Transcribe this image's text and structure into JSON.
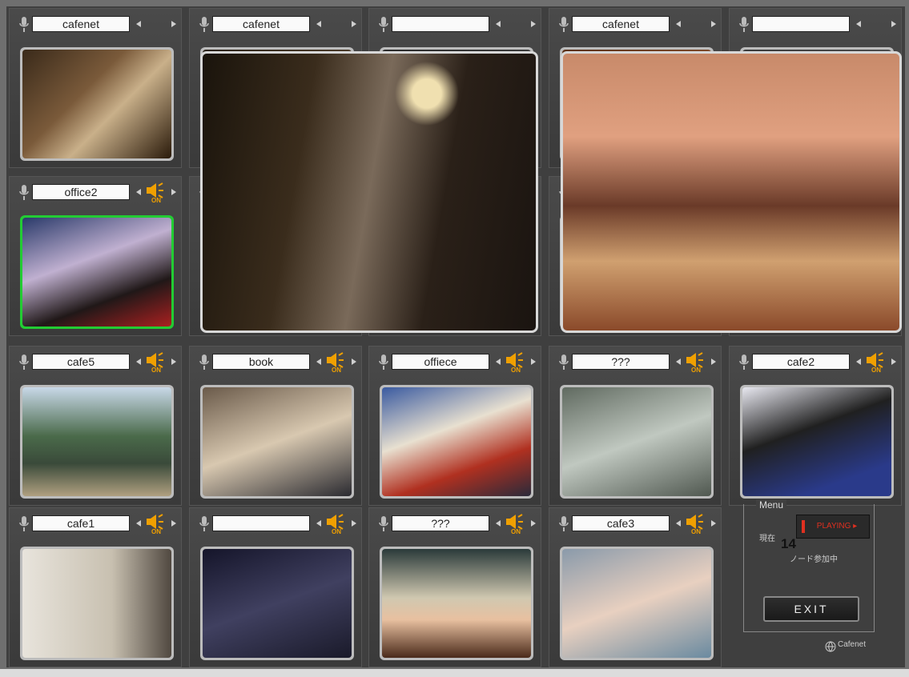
{
  "cameras": [
    {
      "label": "cafenet",
      "sound": false
    },
    {
      "label": "cafenet",
      "sound": false
    },
    {
      "label": "",
      "sound": false
    },
    {
      "label": "cafenet",
      "sound": false
    },
    {
      "label": "",
      "sound": false
    },
    {
      "label": "office2",
      "sound": true
    },
    {
      "label": "",
      "sound": true
    },
    {
      "label": "",
      "sound": true
    },
    {
      "label": "",
      "sound": true
    },
    {
      "label": "",
      "sound": true
    },
    {
      "label": "cafe5",
      "sound": true
    },
    {
      "label": "book",
      "sound": true
    },
    {
      "label": "offiece",
      "sound": true
    },
    {
      "label": "???",
      "sound": true
    },
    {
      "label": "cafe2",
      "sound": true
    },
    {
      "label": "cafe1",
      "sound": true
    },
    {
      "label": "",
      "sound": true
    },
    {
      "label": "???",
      "sound": true
    },
    {
      "label": "cafe3",
      "sound": true
    }
  ],
  "sound_on_label": "ON",
  "menu": {
    "title": "Menu",
    "playing_label": "PLAYING",
    "genzai_label": "現在",
    "node_count": "14",
    "node_label": "ノード参加中",
    "exit_label": "EXIT",
    "brand": "Cafenet"
  },
  "colors": {
    "selected": "#22cc33",
    "speaker": "#f0a000",
    "playing": "#e03020"
  }
}
